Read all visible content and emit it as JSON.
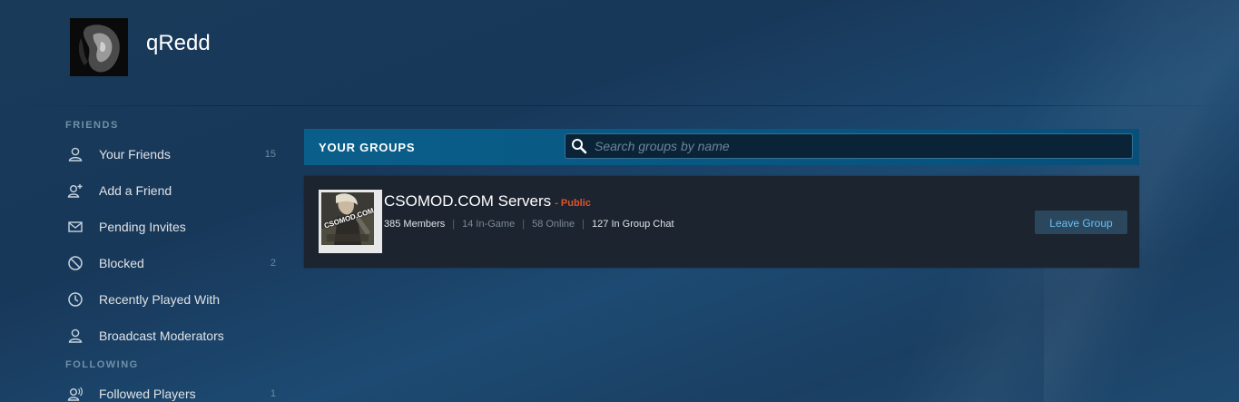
{
  "profile": {
    "name": "qRedd"
  },
  "sidebar": {
    "friends_header": "FRIENDS",
    "friends_items": [
      {
        "label": "Your Friends",
        "count": "15",
        "icon": "person-icon"
      },
      {
        "label": "Add a Friend",
        "count": "",
        "icon": "add-person-icon"
      },
      {
        "label": "Pending Invites",
        "count": "",
        "icon": "envelope-icon"
      },
      {
        "label": "Blocked",
        "count": "2",
        "icon": "blocked-icon"
      },
      {
        "label": "Recently Played With",
        "count": "",
        "icon": "clock-icon"
      },
      {
        "label": "Broadcast Moderators",
        "count": "",
        "icon": "person-icon"
      }
    ],
    "following_header": "FOLLOWING",
    "following_items": [
      {
        "label": "Followed Players",
        "count": "1",
        "icon": "followed-person-icon"
      }
    ]
  },
  "groups": {
    "title": "YOUR GROUPS",
    "search_placeholder": "Search groups by name",
    "items": [
      {
        "name": "CSOMOD.COM Servers",
        "visibility": "- Public",
        "avatar_text": "CSOMOD.COM",
        "members": "385 Members",
        "in_game": "14 In-Game",
        "online": "58 Online",
        "in_chat": "127 In Group Chat",
        "separator": "|",
        "leave_label": "Leave Group"
      }
    ]
  },
  "colors": {
    "accent_bar": "#06507a",
    "public_badge": "#e0532a",
    "leave_button_text": "#67c1f5",
    "card_bg": "#1c242f"
  }
}
